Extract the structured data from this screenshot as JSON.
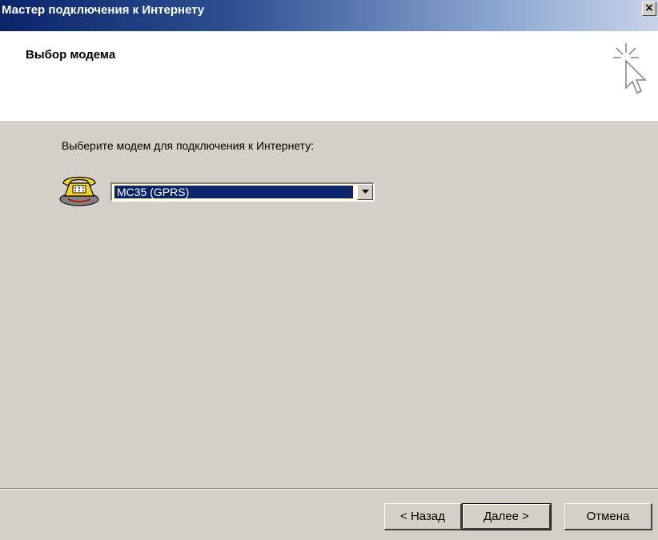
{
  "window": {
    "title": "Мастер подключения к Интернету",
    "close_glyph": "×"
  },
  "header": {
    "title": "Выбор модема",
    "icon": "wizard-cursor-icon"
  },
  "main": {
    "prompt": "Выберите модем для подключения к Интернету:",
    "modem_icon": "telephone-icon",
    "modem_select": {
      "value": "MC35 (GPRS)"
    }
  },
  "buttons": {
    "back": "< Назад",
    "next": "Далее >",
    "cancel": "Отмена"
  },
  "colors": {
    "title_bar_start": "#0a246a",
    "title_bar_end": "#c7d3e9",
    "dialog_face": "#d4d0c8",
    "selection": "#0a246a",
    "phone": "#f5d61c"
  }
}
